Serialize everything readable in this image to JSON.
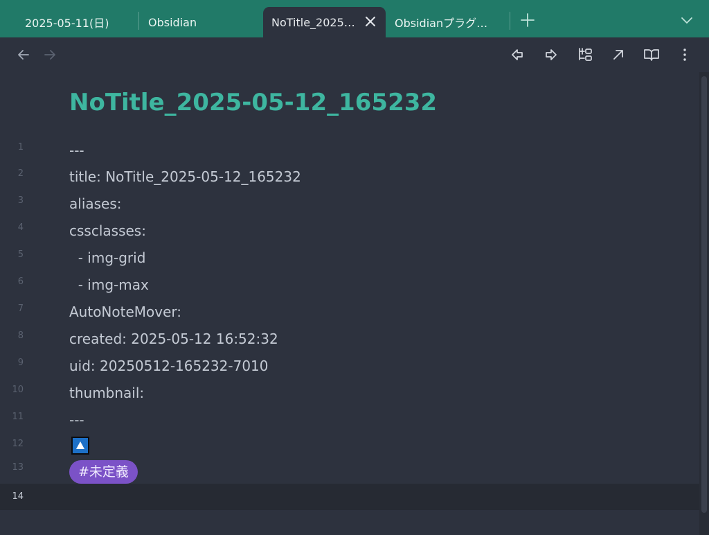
{
  "tabs": [
    {
      "label": "2025-05-11(日)"
    },
    {
      "label": "Obsidian"
    },
    {
      "label": "NoTitle_2025…",
      "active": true
    },
    {
      "label": "Obsidianプラグ…"
    }
  ],
  "icons": {
    "tab_close": "close-icon",
    "new_tab": "plus-icon",
    "tab_list": "chevron-down-icon",
    "back": "arrow-left-icon",
    "forward": "arrow-right-icon",
    "nav_prev": "back-arrow-icon",
    "nav_next": "forward-arrow-icon",
    "outline": "hierarchy-icon",
    "link": "arrow-up-right-icon",
    "reading": "book-open-icon",
    "more": "more-vertical-icon",
    "callout": "warning-icon"
  },
  "colors": {
    "tabbar": "#217a68",
    "background": "#2d323e",
    "title": "#3eb6a0",
    "text": "#c4cad4",
    "tag": "#7b52c7",
    "warning": "#1d70c7"
  },
  "note": {
    "title": "NoTitle_2025-05-12_165232",
    "lines": [
      {
        "num": "1",
        "text": "---"
      },
      {
        "num": "2",
        "text": "title: NoTitle_2025-05-12_165232"
      },
      {
        "num": "3",
        "text": "aliases:"
      },
      {
        "num": "4",
        "text": "cssclasses:"
      },
      {
        "num": "5",
        "text": "  - img-grid"
      },
      {
        "num": "6",
        "text": "  - img-max"
      },
      {
        "num": "7",
        "text": "AutoNoteMover:"
      },
      {
        "num": "8",
        "text": "created: 2025-05-12 16:52:32"
      },
      {
        "num": "9",
        "text": "uid: 20250512-165232-7010"
      },
      {
        "num": "10",
        "text": "thumbnail:"
      },
      {
        "num": "11",
        "text": "---"
      },
      {
        "num": "12",
        "text": ""
      },
      {
        "num": "13",
        "text": ""
      },
      {
        "num": "14",
        "text": ""
      }
    ],
    "tag": "#未定義"
  }
}
